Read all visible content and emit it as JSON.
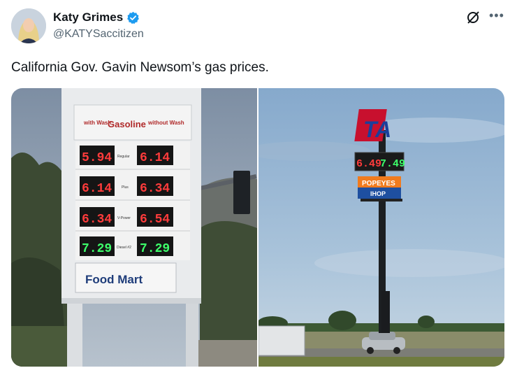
{
  "author": {
    "display_name": "Katy Grimes",
    "handle": "@KATYSaccitizen",
    "verified": true
  },
  "tweet": {
    "text": "California Gov. Gavin Newsom’s  gas prices."
  },
  "icons": {
    "verified": "verified-badge-icon",
    "grok": "grok-icon",
    "more": "more-options-icon"
  },
  "colors": {
    "verified": "#1d9bf0",
    "text_primary": "#0f1419",
    "text_secondary": "#536471",
    "price_red": "#ff3b3b",
    "price_green": "#3dff6a"
  },
  "photo_left": {
    "sign_header": {
      "with_wash": "with Wash",
      "title": "Gasoline",
      "without_wash": "without Wash"
    },
    "rows": [
      {
        "grade": "Regular",
        "with_wash": "5.94",
        "without_wash": "6.14",
        "color": "red"
      },
      {
        "grade": "Plus",
        "with_wash": "6.14",
        "without_wash": "6.34",
        "color": "red"
      },
      {
        "grade": "V-Power",
        "with_wash": "6.34",
        "without_wash": "6.54",
        "color": "red"
      },
      {
        "grade": "Diesel #2",
        "with_wash": "7.29",
        "without_wash": "7.29",
        "color": "green"
      }
    ],
    "store_sign": "Food Mart"
  },
  "photo_right": {
    "logo": "TA",
    "price_left": "6.49",
    "price_right": "7.49",
    "brand_1": "POPEYES",
    "brand_2": "IHOP"
  }
}
